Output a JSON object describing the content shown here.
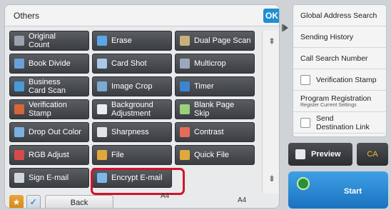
{
  "panel": {
    "title": "Others",
    "ok_label": "OK"
  },
  "functions": [
    {
      "label": "Original\nCount",
      "icon": "original-count-icon",
      "color": "#9aa3ad"
    },
    {
      "label": "Erase",
      "icon": "erase-icon",
      "color": "#5aa7e8"
    },
    {
      "label": "Dual Page Scan",
      "icon": "dual-page-scan-icon",
      "color": "#c9b07a"
    },
    {
      "label": "Book Divide",
      "icon": "book-divide-icon",
      "color": "#6aa0d8"
    },
    {
      "label": "Card Shot",
      "icon": "card-shot-icon",
      "color": "#a9c7e8"
    },
    {
      "label": "Multicrop",
      "icon": "multicrop-icon",
      "color": "#9aa8b8"
    },
    {
      "label": "Business\nCard Scan",
      "icon": "business-card-scan-icon",
      "color": "#4a9ad8"
    },
    {
      "label": "Image Crop",
      "icon": "image-crop-icon",
      "color": "#7da8d0"
    },
    {
      "label": "Timer",
      "icon": "timer-icon",
      "color": "#3a86d0"
    },
    {
      "label": "Verification Stamp",
      "icon": "verification-stamp-icon",
      "color": "#d8643a"
    },
    {
      "label": "Background\nAdjustment",
      "icon": "background-adjustment-icon",
      "color": "#e9eef3"
    },
    {
      "label": "Blank Page\nSkip",
      "icon": "blank-page-skip-icon",
      "color": "#9ad07a"
    },
    {
      "label": "Drop Out Color",
      "icon": "drop-out-color-icon",
      "color": "#7ab0e0"
    },
    {
      "label": "Sharpness",
      "icon": "sharpness-icon",
      "color": "#e0e4e8"
    },
    {
      "label": "Contrast",
      "icon": "contrast-icon",
      "color": "#e86a5a"
    },
    {
      "label": "RGB Adjust",
      "icon": "rgb-adjust-icon",
      "color": "#d84a4a"
    },
    {
      "label": "File",
      "icon": "file-icon",
      "color": "#e0a83a"
    },
    {
      "label": "Quick File",
      "icon": "quick-file-icon",
      "color": "#e0a83a"
    },
    {
      "label": "Sign E-mail",
      "icon": "sign-email-icon",
      "color": "#cfd6dd"
    },
    {
      "label": "Encrypt E-mail",
      "icon": "encrypt-email-icon",
      "color": "#7ab8e8"
    }
  ],
  "bottom": {
    "back_label": "Back",
    "paper_left": "A4",
    "paper_right": "A4"
  },
  "right_panel": {
    "items": [
      {
        "label": "Global Address Search",
        "checkbox": false
      },
      {
        "label": "Sending History",
        "checkbox": false
      },
      {
        "label": "Call Search Number",
        "checkbox": false
      },
      {
        "label": "Verification Stamp",
        "checkbox": true
      },
      {
        "label": "Program Registration",
        "sub": "Register Current Settings",
        "checkbox": false
      },
      {
        "label": "Send\nDestination Link",
        "checkbox": true
      }
    ]
  },
  "actions": {
    "preview_label": "Preview",
    "ca_label": "CA",
    "start_label": "Start"
  },
  "colors": {
    "accent": "#1f8fd1",
    "highlight": "#d0142c",
    "start": "#2a86d6"
  }
}
